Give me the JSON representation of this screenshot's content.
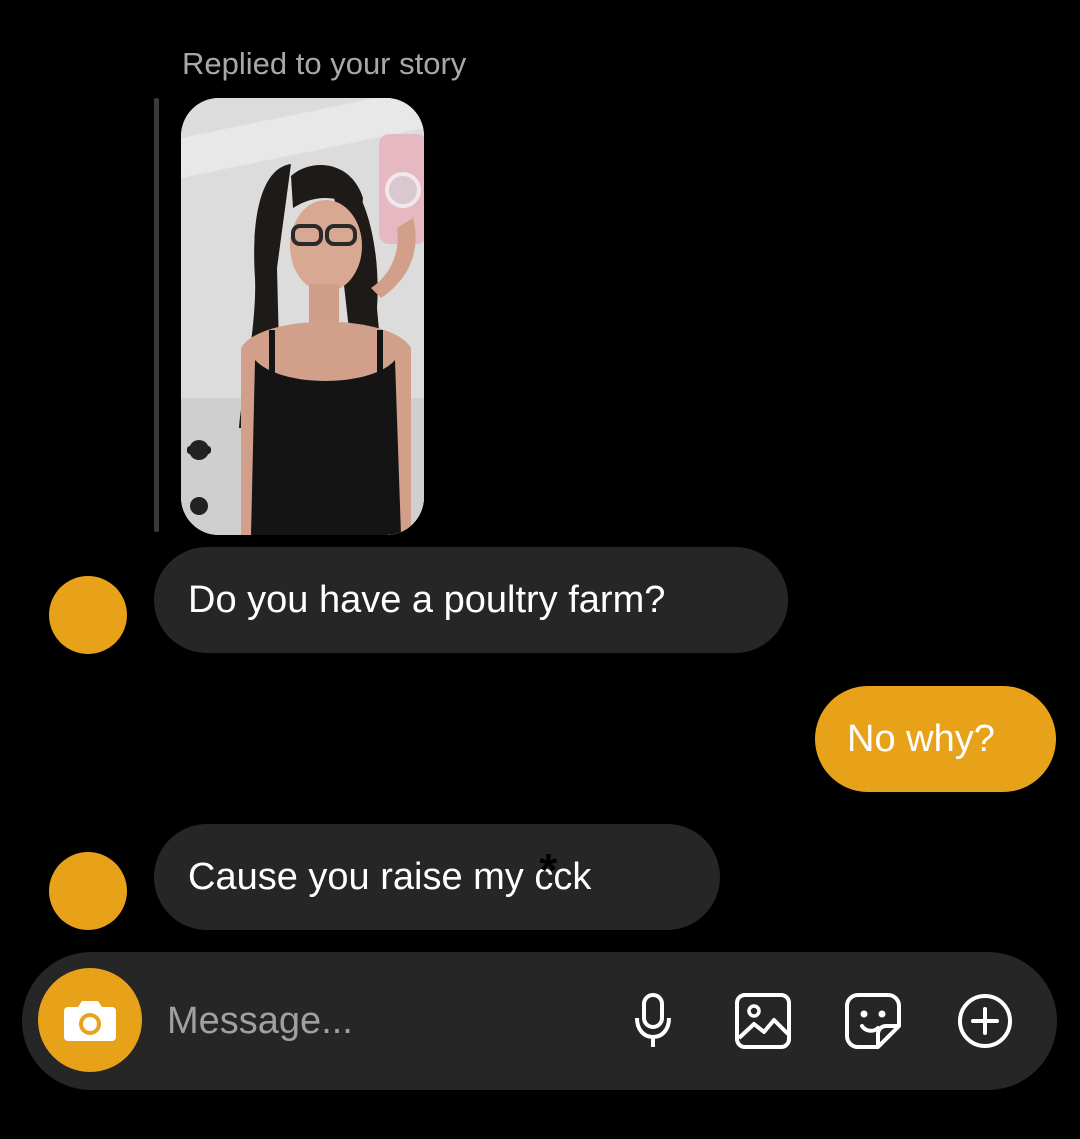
{
  "colors": {
    "accent": "#E8A21A",
    "incoming_bubble": "#262626",
    "composer_bg": "#262626",
    "muted_text": "#A8A8A8"
  },
  "story_reply": {
    "label": "Replied to your story"
  },
  "messages": [
    {
      "direction": "incoming",
      "text": "Do you have a poultry farm?"
    },
    {
      "direction": "outgoing",
      "text": "No why?"
    },
    {
      "direction": "incoming",
      "text_before": "Cause you raise my c",
      "censor": "*",
      "text_after": "ck"
    }
  ],
  "composer": {
    "placeholder": "Message...",
    "icons": [
      "camera-icon",
      "microphone-icon",
      "gallery-icon",
      "sticker-icon",
      "plus-circle-icon"
    ]
  }
}
